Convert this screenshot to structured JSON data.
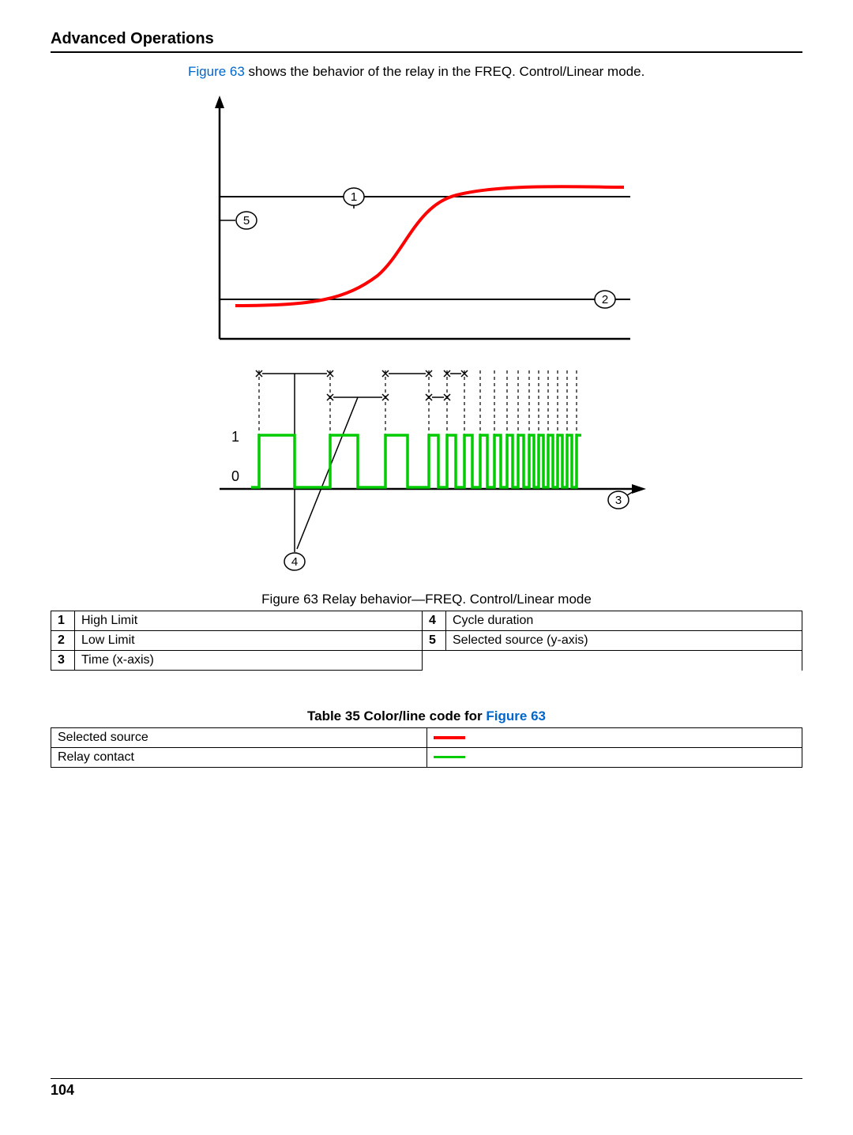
{
  "section_title": "Advanced Operations",
  "intro": {
    "link": "Figure 63",
    "rest": " shows the behavior of the relay in the FREQ. Control/Linear mode."
  },
  "figure": {
    "callouts": {
      "c1": "1",
      "c2": "2",
      "c3": "3",
      "c4": "4",
      "c5": "5"
    },
    "yticks": {
      "one": "1",
      "zero": "0"
    },
    "caption": "Figure 63  Relay behavior—FREQ. Control/Linear mode"
  },
  "legend": {
    "rows": [
      {
        "n": "1",
        "t": "High Limit"
      },
      {
        "n": "2",
        "t": "Low Limit"
      },
      {
        "n": "3",
        "t": "Time (x-axis)"
      },
      {
        "n": "4",
        "t": "Cycle duration"
      },
      {
        "n": "5",
        "t": "Selected source (y-axis)"
      }
    ]
  },
  "table35": {
    "caption_prefix": "Table 35  Color/line code for ",
    "caption_link": "Figure 63",
    "rows": [
      {
        "label": "Selected source",
        "swatch": "red"
      },
      {
        "label": "Relay contact",
        "swatch": "green"
      }
    ]
  },
  "page_number": "104",
  "chart_data": {
    "type": "line",
    "title": "Relay behavior—FREQ. Control/Linear mode",
    "xlabel": "Time",
    "ylabel": "Selected source",
    "annotations": [
      {
        "id": 1,
        "label": "High Limit"
      },
      {
        "id": 2,
        "label": "Low Limit"
      },
      {
        "id": 3,
        "label": "Time (x-axis)"
      },
      {
        "id": 4,
        "label": "Cycle duration"
      },
      {
        "id": 5,
        "label": "Selected source (y-axis)"
      }
    ],
    "series": [
      {
        "name": "Selected source",
        "color": "#ff0000",
        "description": "S-curve rising from below Low Limit to above High Limit over time"
      },
      {
        "name": "Relay contact",
        "color": "#00cc00",
        "description": "Pulse train between 0 and 1 with decreasing cycle duration as source rises"
      }
    ],
    "relay_y_levels": [
      0,
      1
    ]
  }
}
